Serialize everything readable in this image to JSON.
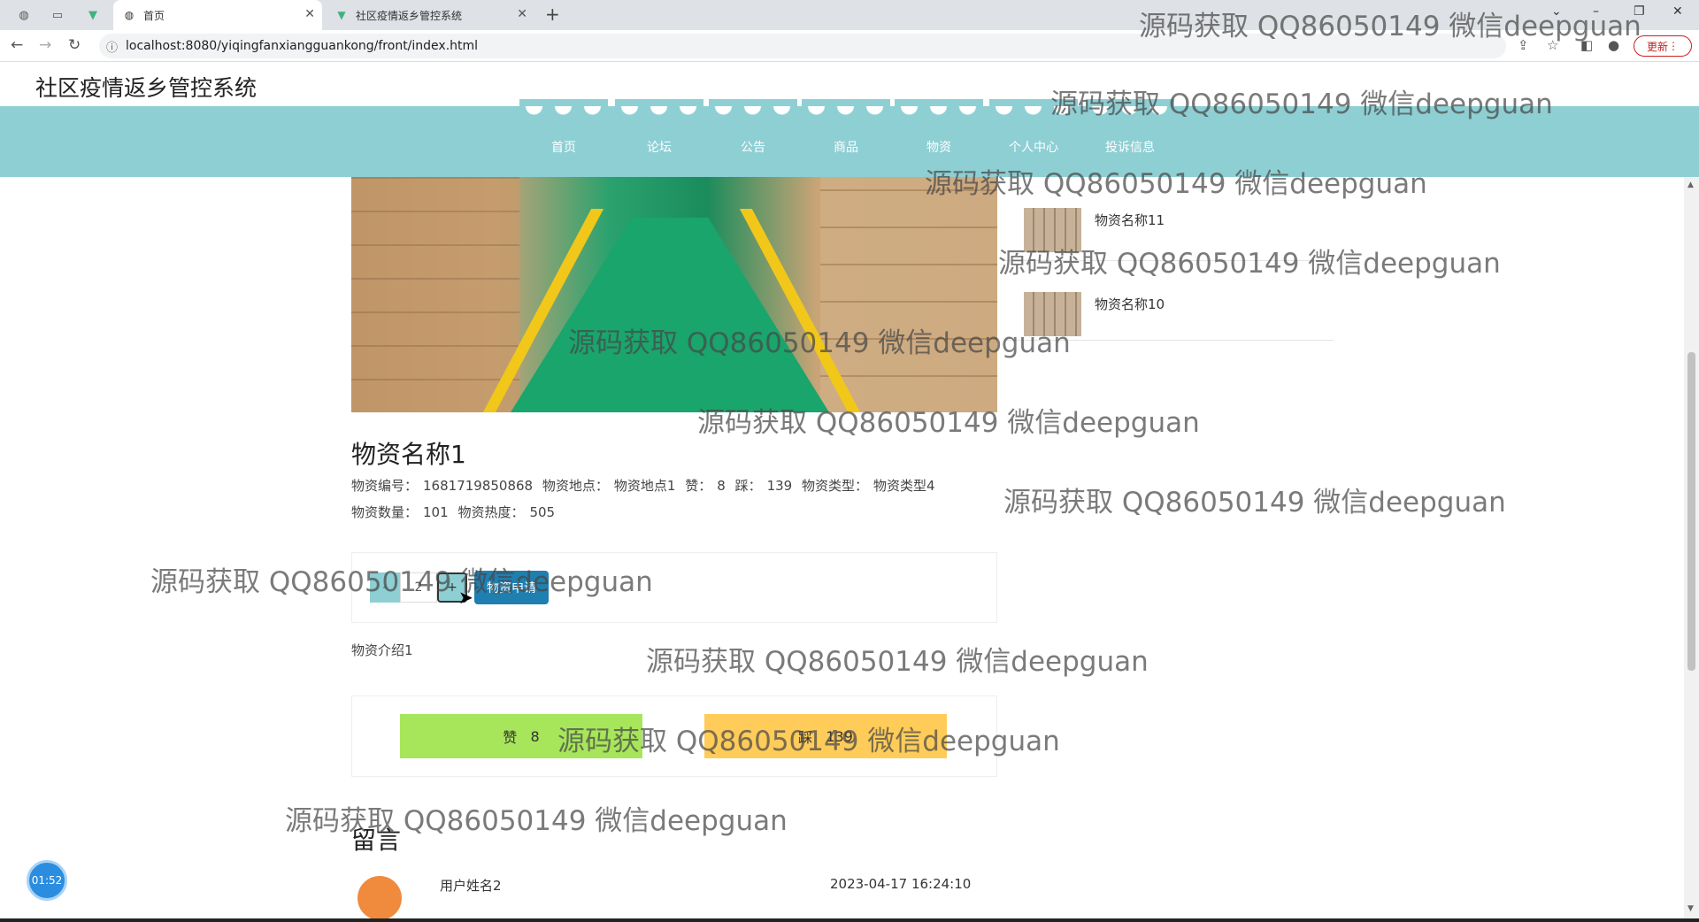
{
  "browser": {
    "tabs": [
      {
        "title": "首页",
        "active": true
      },
      {
        "title": "社区疫情返乡管控系统",
        "active": false
      }
    ],
    "url": "localhost:8080/yiqingfanxiangguankong/front/index.html",
    "update_label": "更新"
  },
  "site": {
    "title": "社区疫情返乡管控系统",
    "nav": [
      "首页",
      "论坛",
      "公告",
      "商品",
      "物资",
      "个人中心",
      "投诉信息"
    ]
  },
  "sidebar": {
    "items": [
      {
        "name": "物资名称11"
      },
      {
        "name": "物资名称10"
      }
    ]
  },
  "product": {
    "name": "物资名称1",
    "code_label": "物资编号：",
    "code": "1681719850868",
    "location_label": "物资地点：",
    "location": "物资地点1",
    "like_label": "赞：",
    "like": "8",
    "dislike_label": "踩：",
    "dislike": "139",
    "type_label": "物资类型：",
    "type": "物资类型4",
    "qty_label": "物资数量：",
    "qty": "101",
    "heat_label": "物资热度：",
    "heat": "505",
    "intro": "物资介绍1"
  },
  "action": {
    "minus": "-",
    "qty_value": "2",
    "plus": "+",
    "apply_label": "物资申请"
  },
  "vote": {
    "like_label": "赞",
    "like_count": "8",
    "dislike_label": "踩",
    "dislike_count": "139"
  },
  "messages": {
    "title": "留言",
    "items": [
      {
        "user": "用户姓名2",
        "time": "2023-04-17 16:24:10"
      }
    ]
  },
  "timer": "01:52",
  "watermark": "源码获取 QQ86050149 微信deepguan",
  "colors": {
    "nav": "#8ecfd4",
    "apply": "#1e7fb0",
    "like": "#a7e65a",
    "dislike": "#ffcc5a"
  }
}
